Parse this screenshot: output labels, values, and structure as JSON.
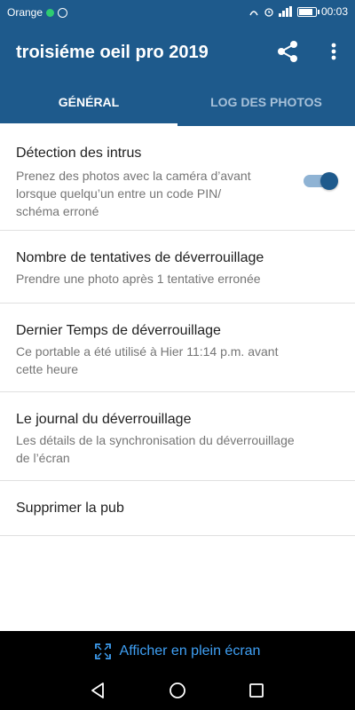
{
  "status_bar": {
    "carrier": "Orange",
    "time": "00:03",
    "battery_level": 0.9
  },
  "app_bar": {
    "title": "troisiéme oeil pro 2019",
    "share_icon": "share-icon",
    "more_icon": "more-vert-icon"
  },
  "tabs": [
    {
      "label": "GÉNÉRAL",
      "active": true
    },
    {
      "label": "LOG DES PHOTOS",
      "active": false
    }
  ],
  "settings": [
    {
      "title": "Détection des intrus",
      "subtitle": [
        "Prenez des photos avec la caméra d’avant",
        "lorsque quelqu’un entre un code PIN/",
        "schéma erroné"
      ],
      "toggle_on": true
    },
    {
      "title": "Nombre de tentatives de déverrouillage",
      "subtitle": [
        "Prendre une photo après 1 tentative erronée"
      ]
    },
    {
      "title": "Dernier Temps de déverrouillage",
      "subtitle": [
        "Ce portable a été utilisé à Hier  11:14 p.m. avant",
        "cette heure"
      ]
    },
    {
      "title": "Le journal du déverrouillage",
      "subtitle": [
        "Les détails de la synchronisation du déverrouillage",
        "de l’écran"
      ]
    },
    {
      "title": "Supprimer la pub",
      "subtitle": []
    }
  ],
  "ad_banner": {
    "label": "Afficher en plein écran",
    "icon": "fullscreen-icon"
  },
  "nav": {
    "back_icon": "back-icon",
    "home_icon": "home-icon",
    "recents_icon": "recents-icon"
  },
  "colors": {
    "primary": "#1e5a8c",
    "accent_link": "#3fa0f5",
    "toggle_track": "#8fb3d4"
  }
}
